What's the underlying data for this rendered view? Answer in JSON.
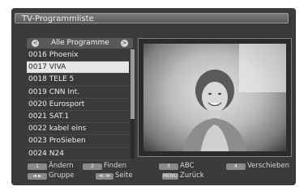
{
  "window": {
    "title": "TV-Programmliste"
  },
  "group_selector": {
    "left_arrow": "<",
    "right_arrow": ">",
    "label": "Alle Programme"
  },
  "channels": [
    {
      "label": "0016 Phoenix"
    },
    {
      "label": "0017 VIVA",
      "selected": true
    },
    {
      "label": "0018 TELE 5"
    },
    {
      "label": "0019 CNN Int."
    },
    {
      "label": "0020 Eurosport"
    },
    {
      "label": "0021 SAT.1"
    },
    {
      "label": "0022 kabel eins"
    },
    {
      "label": "0023 ProSieben"
    },
    {
      "label": "0024 N24"
    }
  ],
  "footer": {
    "red_key": "1",
    "red_label": "Ändern",
    "green_key": "2",
    "green_label": "Finden",
    "yellow_key": "3",
    "yellow_label": "ABC",
    "blue_key": "4",
    "blue_label": "Verschieben",
    "group_key": "◄ ►",
    "group_label": "Gruppe",
    "page_key": "≪ ≫",
    "page_label": "Seite",
    "menu_key": "MENU",
    "menu_label": "Zurück"
  },
  "icons": {
    "scroll": "scrollbar",
    "preview": "tv-preview-image"
  }
}
